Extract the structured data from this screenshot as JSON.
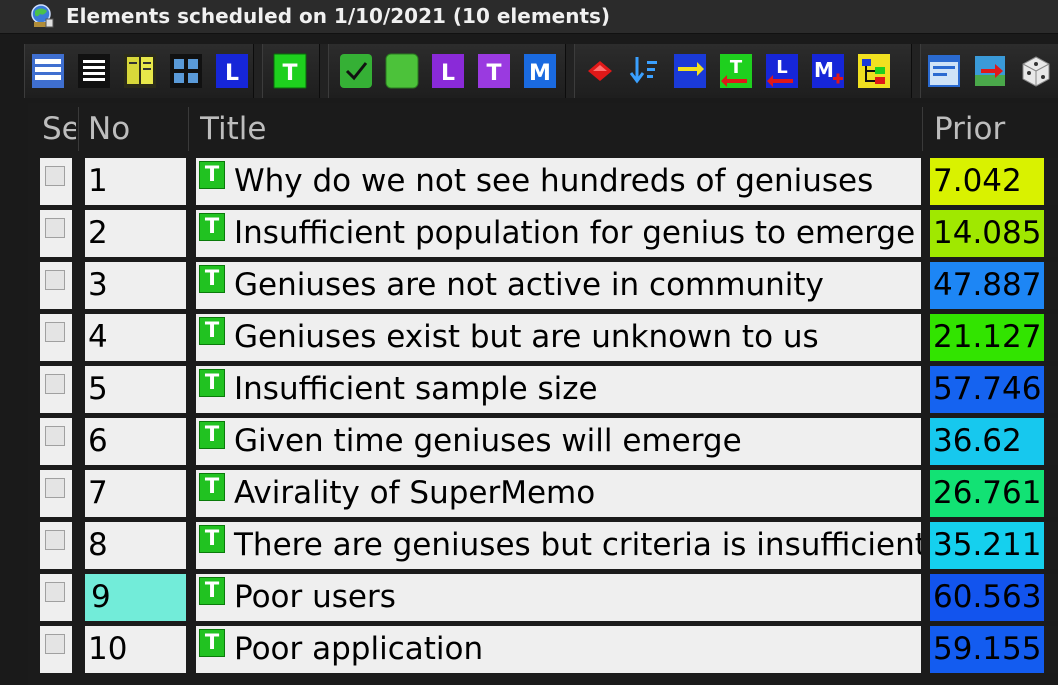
{
  "window": {
    "title": "Elements scheduled on 1/10/2021 (10 elements)"
  },
  "toolbar": {
    "buttons": [
      {
        "name": "list-view-icon"
      },
      {
        "name": "compact-list-icon"
      },
      {
        "name": "columns-icon"
      },
      {
        "name": "grid-view-icon"
      },
      {
        "name": "filter-l-icon",
        "glyph": "L"
      },
      {
        "name": "filter-t-icon",
        "glyph": "T"
      },
      {
        "name": "checkmark-icon"
      },
      {
        "name": "green-square-icon"
      },
      {
        "name": "purple-l-icon",
        "glyph": "L"
      },
      {
        "name": "purple-t-icon",
        "glyph": "T"
      },
      {
        "name": "blue-m-icon",
        "glyph": "M"
      },
      {
        "name": "red-diamond-icon"
      },
      {
        "name": "sort-down-icon"
      },
      {
        "name": "arrows-icon"
      },
      {
        "name": "t-arrow-icon"
      },
      {
        "name": "l-arrow-icon"
      },
      {
        "name": "m-plus-icon"
      },
      {
        "name": "tree-icon"
      },
      {
        "name": "window-icon"
      },
      {
        "name": "export-icon"
      },
      {
        "name": "dice-icon"
      }
    ]
  },
  "columns": {
    "sel": "Sel",
    "no": "No",
    "title": "Title",
    "prior": "Prior"
  },
  "rows": [
    {
      "no": "1",
      "title": "Why do we not see hundreds of geniuses",
      "prior": "7.042",
      "prior_color": "#d9f200"
    },
    {
      "no": "2",
      "title": "Insufficient population for genius to emerge",
      "prior": "14.085",
      "prior_color": "#a0e800"
    },
    {
      "no": "3",
      "title": "Geniuses are not active in community",
      "prior": "47.887",
      "prior_color": "#1d86f5"
    },
    {
      "no": "4",
      "title": "Geniuses exist but are unknown to us",
      "prior": "21.127",
      "prior_color": "#32e400"
    },
    {
      "no": "5",
      "title": "Insufficient sample size",
      "prior": "57.746",
      "prior_color": "#1563f0"
    },
    {
      "no": "6",
      "title": "Given time geniuses will emerge",
      "prior": "36.62",
      "prior_color": "#17c8ee"
    },
    {
      "no": "7",
      "title": "Avirality of SuperMemo",
      "prior": "26.761",
      "prior_color": "#12e274"
    },
    {
      "no": "8",
      "title": "There are geniuses but criteria is insufficient",
      "prior": "35.211",
      "prior_color": "#15d0ee"
    },
    {
      "no": "9",
      "title": "Poor users",
      "prior": "60.563",
      "prior_color": "#1254ee"
    },
    {
      "no": "10",
      "title": "Poor application",
      "prior": "59.155",
      "prior_color": "#135cf0"
    }
  ],
  "active_row_index": 8,
  "colors": {
    "active_cell": "#72ecd9",
    "row_bg": "#efefef",
    "header_text": "#bdbdbd",
    "window_bg": "#1a1a1a"
  }
}
